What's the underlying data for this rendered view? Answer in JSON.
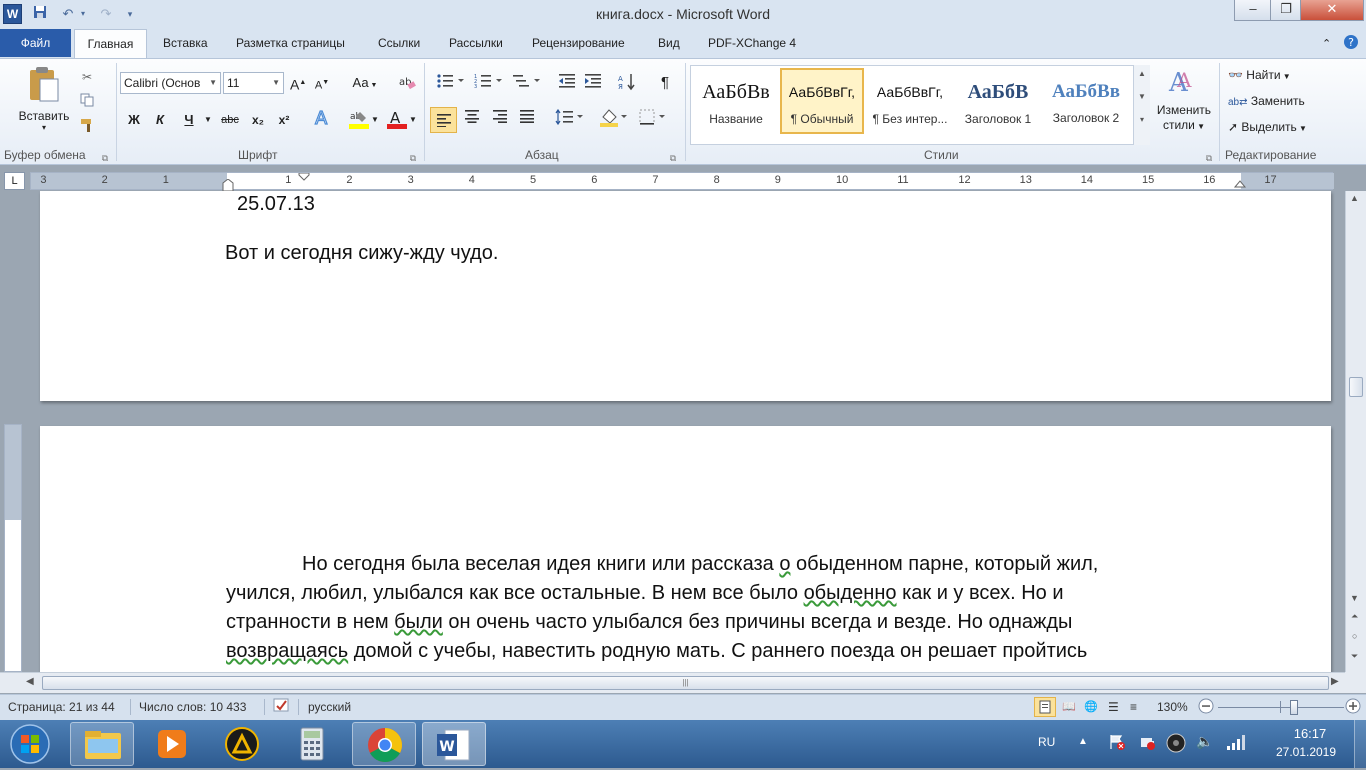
{
  "window": {
    "title": "книга.docx - Microsoft Word",
    "app_icon": "word-icon",
    "controls": [
      "minimize-icon",
      "maximize-icon",
      "close-icon"
    ]
  },
  "ribbon_tabs": {
    "file": "Файл",
    "items": [
      "Главная",
      "Вставка",
      "Разметка страницы",
      "Ссылки",
      "Рассылки",
      "Рецензирование",
      "Вид",
      "PDF-XChange 4"
    ],
    "active": "Главная"
  },
  "clipboard": {
    "paste_label": "Вставить",
    "group_label": "Буфер обмена"
  },
  "font": {
    "name": "Calibri (Основ",
    "size": "11",
    "group_label": "Шрифт",
    "bold": "Ж",
    "italic": "К",
    "underline": "Ч",
    "strike": "abc",
    "subscript": "x₂",
    "superscript": "x²",
    "change_case": "Аа",
    "grow": "A",
    "shrink": "A"
  },
  "paragraph": {
    "group_label": "Абзац",
    "pilcrow": "¶"
  },
  "styles": {
    "group_label": "Стили",
    "items": [
      {
        "sample": "АаБбВв",
        "name": "Название"
      },
      {
        "sample": "АаБбВвГг,",
        "name": "¶ Обычный"
      },
      {
        "sample": "АаБбВвГг,",
        "name": "¶ Без интер..."
      },
      {
        "sample": "АаБбВ",
        "name": "Заголовок 1"
      },
      {
        "sample": "АаБбВв",
        "name": "Заголовок 2"
      }
    ],
    "selected_index": 1,
    "change_styles_line1": "Изменить",
    "change_styles_line2": "стили"
  },
  "editing": {
    "group_label": "Редактирование",
    "find": "Найти",
    "replace": "Заменить",
    "select": "Выделить"
  },
  "ruler": {
    "numbers": [
      "3",
      "2",
      "1",
      "1",
      "2",
      "3",
      "4",
      "5",
      "6",
      "7",
      "8",
      "9",
      "10",
      "11",
      "12",
      "13",
      "14",
      "15",
      "16",
      "17"
    ],
    "corner": "L"
  },
  "document": {
    "date_line": "25.07.13",
    "line1": "Вот и сегодня сижу-жду чудо.",
    "paragraph_lines": [
      {
        "parts": [
          {
            "t": "Но сегодня была веселая идея книги или рассказа "
          },
          {
            "t": "о",
            "sq": true
          },
          {
            "t": " обыденном парне, который жил,"
          }
        ]
      },
      {
        "parts": [
          {
            "t": "учился, любил, улыбался как все остальные. В нем все было "
          },
          {
            "t": "обыденно",
            "sq": true
          },
          {
            "t": " как и у всех. Но и"
          }
        ]
      },
      {
        "parts": [
          {
            "t": "странности в нем "
          },
          {
            "t": "были",
            "sq": true
          },
          {
            "t": " он очень часто улыбался без причины всегда и везде.   Но однажды"
          }
        ]
      },
      {
        "parts": [
          {
            "t": "возвращаясь",
            "sq": true
          },
          {
            "t": " домой с учебы, навестить родную мать. С раннего поезда он решает пройтись"
          }
        ]
      }
    ]
  },
  "statusbar": {
    "page": "Страница: 21 из 44",
    "words": "Число слов: 10 433",
    "language": "русский",
    "zoom": "130%",
    "zoom_level_fraction": 0.6
  },
  "taskbar": {
    "apps": [
      "explorer-icon",
      "media-player-icon",
      "archicad-icon",
      "calculator-icon",
      "chrome-icon",
      "word-icon"
    ],
    "active_app": "word-icon",
    "lang": "RU",
    "time": "16:17",
    "date": "27.01.2019"
  },
  "colors": {
    "file_tab": "#2a5caa",
    "taskbar": "#3a6aa0",
    "selected_style_border": "#e8b64c",
    "squiggle": "#3a9a3a"
  }
}
